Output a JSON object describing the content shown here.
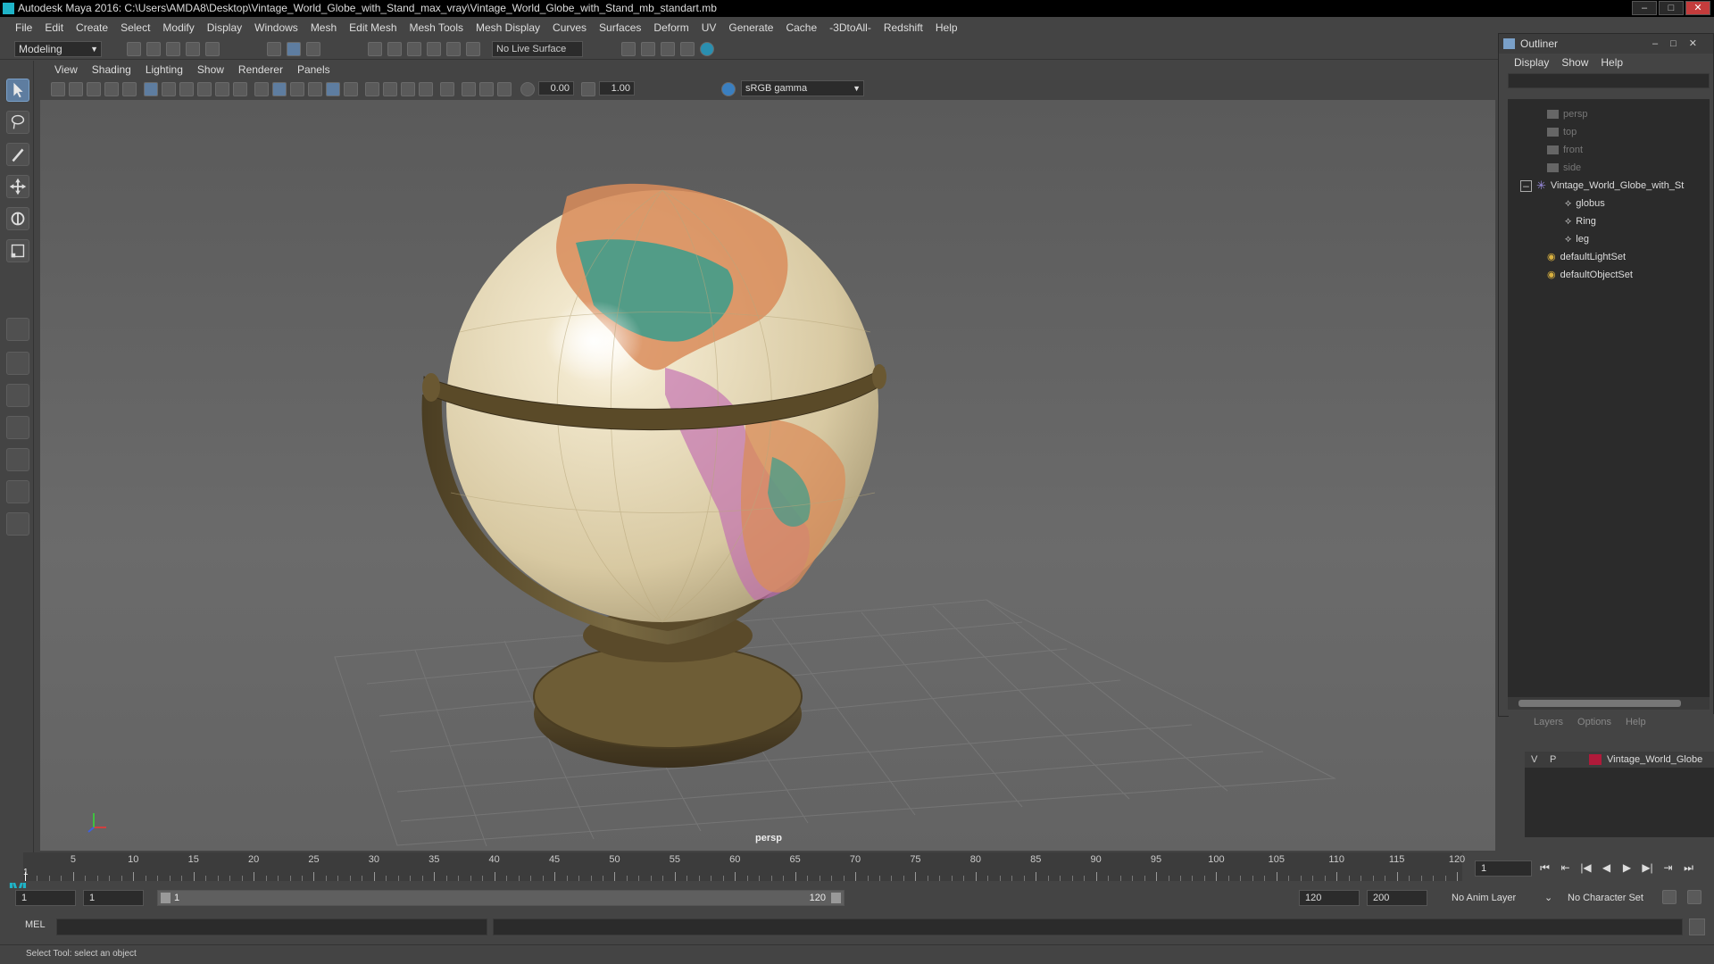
{
  "window": {
    "title": "Autodesk Maya 2016: C:\\Users\\AMDA8\\Desktop\\Vintage_World_Globe_with_Stand_max_vray\\Vintage_World_Globe_with_Stand_mb_standart.mb",
    "min": "–",
    "max": "□",
    "close": "✕"
  },
  "menubar": [
    "File",
    "Edit",
    "Create",
    "Select",
    "Modify",
    "Display",
    "Windows",
    "Mesh",
    "Edit Mesh",
    "Mesh Tools",
    "Mesh Display",
    "Curves",
    "Surfaces",
    "Deform",
    "UV",
    "Generate",
    "Cache",
    "-3DtoAll-",
    "Redshift",
    "Help"
  ],
  "statusline": {
    "mode": "Modeling",
    "live_surface": "No Live Surface"
  },
  "viewport": {
    "menu": [
      "View",
      "Shading",
      "Lighting",
      "Show",
      "Renderer",
      "Panels"
    ],
    "exposure": "0.00",
    "gamma_value": "1.00",
    "color_space": "sRGB gamma",
    "camera_label": "persp"
  },
  "outliner": {
    "title": "Outliner",
    "menu": [
      "Display",
      "Show",
      "Help"
    ],
    "items": [
      {
        "label": "persp",
        "type": "camera"
      },
      {
        "label": "top",
        "type": "camera"
      },
      {
        "label": "front",
        "type": "camera"
      },
      {
        "label": "side",
        "type": "camera"
      },
      {
        "label": "Vintage_World_Globe_with_St",
        "type": "group"
      },
      {
        "label": "globus",
        "type": "mesh"
      },
      {
        "label": "Ring",
        "type": "mesh"
      },
      {
        "label": "leg",
        "type": "mesh"
      },
      {
        "label": "defaultLightSet",
        "type": "set"
      },
      {
        "label": "defaultObjectSet",
        "type": "set"
      }
    ]
  },
  "layers": {
    "menu": [
      "Layers",
      "Options",
      "Help"
    ],
    "row": {
      "v": "V",
      "p": "P",
      "name": "Vintage_World_Globe",
      "color": "#b01a3a"
    }
  },
  "timeline": {
    "ticks": [
      "5",
      "10",
      "15",
      "20",
      "25",
      "30",
      "35",
      "40",
      "45",
      "50",
      "55",
      "60",
      "65",
      "70",
      "75",
      "80",
      "85",
      "90",
      "95",
      "100",
      "105",
      "110",
      "115",
      "120"
    ],
    "current_frame_marker": "1",
    "current_frame": "1"
  },
  "range": {
    "start": "1",
    "playback_start": "1",
    "slider_start": "1",
    "slider_end": "120",
    "playback_end": "120",
    "end": "200",
    "anim_layer": "No Anim Layer",
    "character_set": "No Character Set"
  },
  "cmdline": {
    "label": "MEL"
  },
  "helpline": {
    "text": "Select Tool: select an object"
  },
  "colors": {
    "accent": "#1fb4c8",
    "selection": "#5e7da0"
  }
}
